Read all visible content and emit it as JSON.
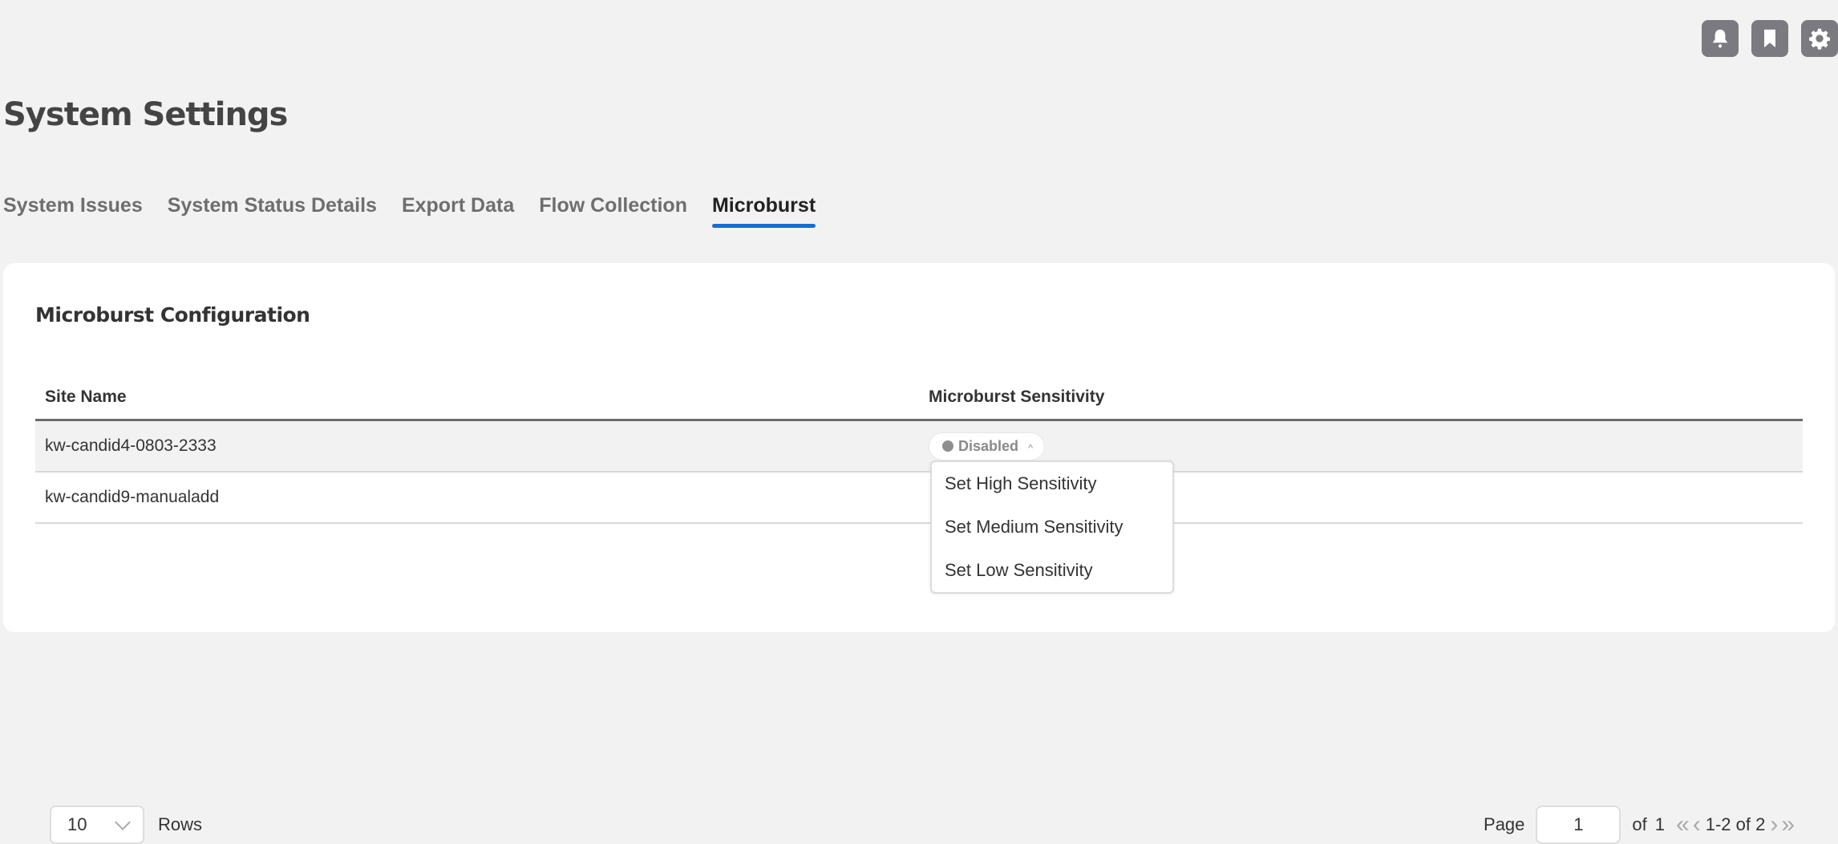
{
  "header": {
    "icons": [
      {
        "name": "notifications",
        "glyph": "bell-icon"
      },
      {
        "name": "bookmarks",
        "glyph": "bookmark-icon"
      },
      {
        "name": "settings",
        "glyph": "gear-icon"
      }
    ],
    "title": "System Settings"
  },
  "tabs": [
    {
      "label": "System Issues",
      "active": false
    },
    {
      "label": "System Status Details",
      "active": false
    },
    {
      "label": "Export Data",
      "active": false
    },
    {
      "label": "Flow Collection",
      "active": false
    },
    {
      "label": "Microburst",
      "active": true
    }
  ],
  "accent_color": "#1f6bc6",
  "card": {
    "title": "Microburst Configuration",
    "table": {
      "columns": [
        "Site Name",
        "Microburst Sensitivity"
      ],
      "rows": [
        {
          "site": "kw-candid4-0803-2333",
          "sensitivity": "Disabled",
          "dropdown_open": true
        },
        {
          "site": "kw-candid9-manualadd",
          "sensitivity": ""
        }
      ]
    },
    "sensitivity_menu": [
      "Set High Sensitivity",
      "Set Medium Sensitivity",
      "Set Low Sensitivity"
    ],
    "pagination": {
      "rows_per_page": "10",
      "rows_label": "Rows",
      "page_label": "Page",
      "current_page": "1",
      "of_label": "of",
      "total_pages": "1",
      "range_text": "1-2 of 2",
      "first_glyph": "«",
      "prev_glyph": "‹",
      "next_glyph": "›",
      "last_glyph": "»"
    }
  }
}
